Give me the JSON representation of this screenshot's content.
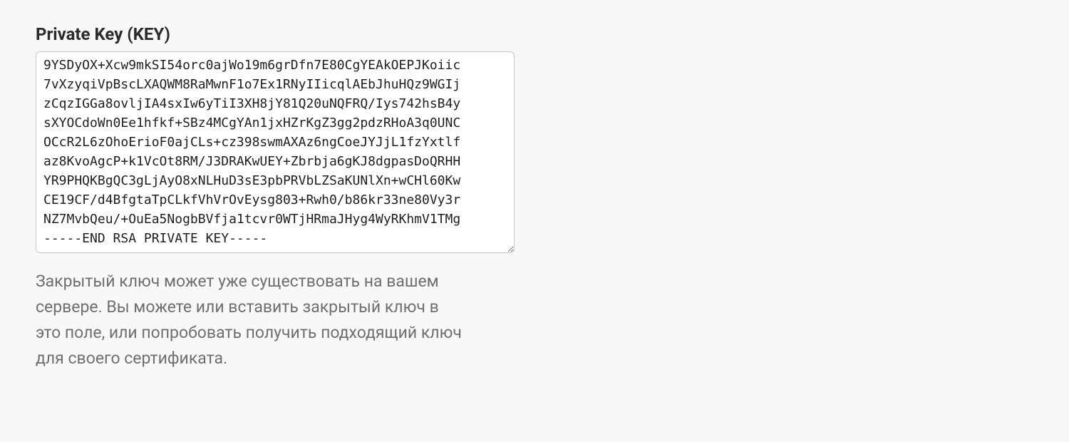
{
  "section": {
    "label": "Private Key (KEY)",
    "helpText": "Закрытый ключ может уже существовать на вашем сервере. Вы можете или вставить закрытый ключ в это поле, или попробовать получить подходящий ключ для своего сертификата."
  },
  "privateKeyField": {
    "value": "9YSDyOX+Xcw9mkSI54orc0ajWo19m6grDfn7E80CgYEAkOEPJKoiic\n7vXzyqiVpBscLXAQWM8RaMwnF1o7Ex1RNyIIicqlAEbJhuHQz9WGIj\nzCqzIGGa8ovljIA4sxIw6yTiI3XH8jY81Q20uNQFRQ/Iys742hsB4y\nsXYOCdoWn0Ee1hfkf+SBz4MCgYAn1jxHZrKgZ3gg2pdzRHoA3q0UNC\nOCcR2L6zOhoErioF0ajCLs+cz398swmAXAz6ngCoeJYJjL1fzYxtlf\naz8KvoAgcP+k1VcOt8RM/J3DRAKwUEY+Zbrbja6gKJ8dgpasDoQRHH\nYR9PHQKBgQC3gLjAyO8xNLHuD3sE3pbPRVbLZSaKUNlXn+wCHl60Kw\nCE19CF/d4BfgtaTpCLkfVhVrOvEysg803+Rwh0/b86kr33ne80Vy3r\nNZ7MvbQeu/+OuEa5NogbBVfja1tcvr0WTjHRmaJHyg4WyRKhmV1TMg\n-----END RSA PRIVATE KEY-----"
  }
}
